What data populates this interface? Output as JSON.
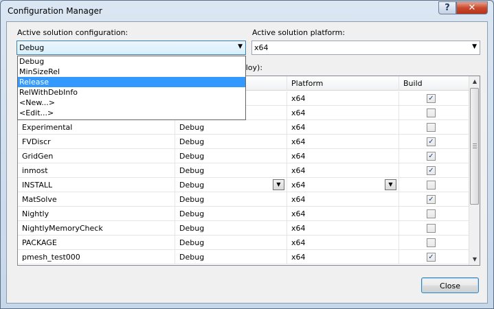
{
  "window": {
    "title": "Configuration Manager",
    "help_glyph": "?",
    "close_glyph": "✕"
  },
  "solution_config": {
    "label": "Active solution configuration:",
    "value": "Debug",
    "options": [
      "Debug",
      "MinSizeRel",
      "Release",
      "RelWithDebInfo",
      "<New...>",
      "<Edit...>"
    ],
    "highlighted": "Release"
  },
  "solution_platform": {
    "label": "Active solution platform:",
    "value": "x64"
  },
  "project_contexts": {
    "label_fragment": "eploy):",
    "columns": [
      "Platform",
      "Build"
    ],
    "rows": [
      {
        "project": "",
        "configuration": "",
        "platform": "x64",
        "build": true
      },
      {
        "project": "",
        "configuration": "",
        "platform": "x64",
        "build": false
      },
      {
        "project": "Experimental",
        "configuration": "Debug",
        "platform": "x64",
        "build": false
      },
      {
        "project": "FVDiscr",
        "configuration": "Debug",
        "platform": "x64",
        "build": true
      },
      {
        "project": "GridGen",
        "configuration": "Debug",
        "platform": "x64",
        "build": true
      },
      {
        "project": "inmost",
        "configuration": "Debug",
        "platform": "x64",
        "build": true
      },
      {
        "project": "INSTALL",
        "configuration": "Debug",
        "platform": "x64",
        "build": false
      },
      {
        "project": "MatSolve",
        "configuration": "Debug",
        "platform": "x64",
        "build": true
      },
      {
        "project": "Nightly",
        "configuration": "Debug",
        "platform": "x64",
        "build": false
      },
      {
        "project": "NightlyMemoryCheck",
        "configuration": "Debug",
        "platform": "x64",
        "build": false
      },
      {
        "project": "PACKAGE",
        "configuration": "Debug",
        "platform": "x64",
        "build": false
      },
      {
        "project": "pmesh_test000",
        "configuration": "Debug",
        "platform": "x64",
        "build": true
      }
    ]
  },
  "footer": {
    "close_label": "Close"
  }
}
